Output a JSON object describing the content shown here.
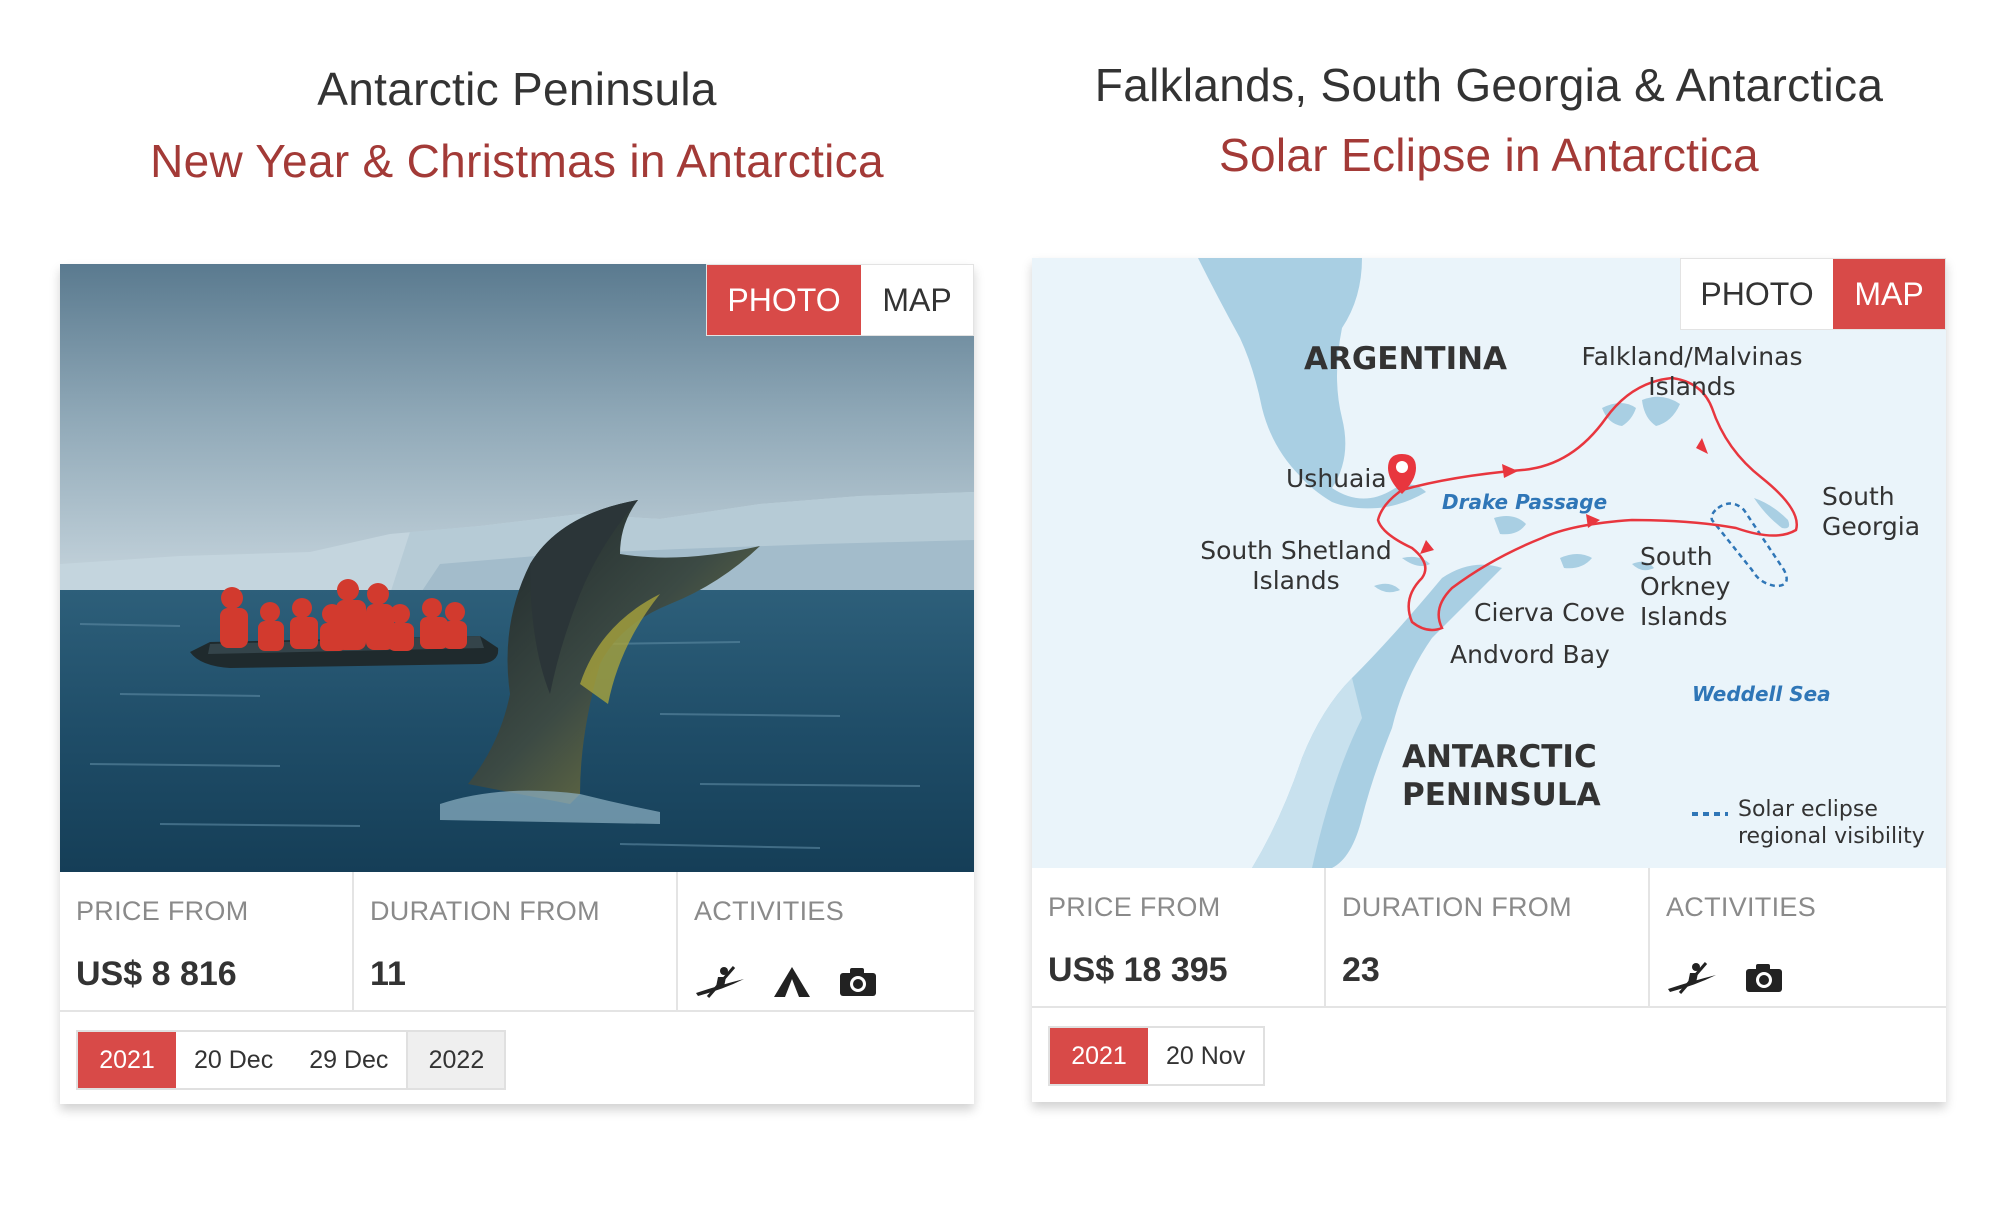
{
  "trips": [
    {
      "region": "Antarctic Peninsula",
      "trip_name": "New Year & Christmas in Antarctica",
      "media_toggle": {
        "photo_label": "PHOTO",
        "map_label": "MAP",
        "active": "photo"
      },
      "price_label": "PRICE FROM",
      "price_value": "US$ 8 816",
      "duration_label": "DURATION FROM",
      "duration_value": "11",
      "activities_label": "ACTIVITIES",
      "activities": [
        "kayak-icon",
        "camping-icon",
        "camera-icon"
      ],
      "dates": {
        "year": "2021",
        "date_1": "20 Dec",
        "date_2": "29 Dec",
        "next_year": "2022"
      }
    },
    {
      "region": "Falklands, South Georgia & Antarctica",
      "trip_name": "Solar Eclipse in Antarctica",
      "media_toggle": {
        "photo_label": "PHOTO",
        "map_label": "MAP",
        "active": "map"
      },
      "price_label": "PRICE FROM",
      "price_value": "US$ 18 395",
      "duration_label": "DURATION FROM",
      "duration_value": "23",
      "activities_label": "ACTIVITIES",
      "activities": [
        "kayak-icon",
        "camera-icon"
      ],
      "dates": {
        "year": "2021",
        "date_1": "20 Nov"
      },
      "map": {
        "argentina": "ARGENTINA",
        "falklands": "Falkland/Malvinas\nIslands",
        "ushuaia": "Ushuaia",
        "drake": "Drake Passage",
        "south_georgia": "South\nGeorgia",
        "south_shetland": "South Shetland\nIslands",
        "south_orkney": "South\nOrkney\nIslands",
        "cierva": "Cierva Cove",
        "andvord": "Andvord Bay",
        "weddell": "Weddell Sea",
        "peninsula": "ANTARCTIC\nPENINSULA",
        "legend": "Solar eclipse\nregional visibility"
      }
    }
  ],
  "colors": {
    "accent": "#d84a48",
    "trip_title": "#a33a37",
    "route": "#e8363e",
    "map_sea": "#eaf4fa",
    "map_land": "#a9cfe3"
  }
}
